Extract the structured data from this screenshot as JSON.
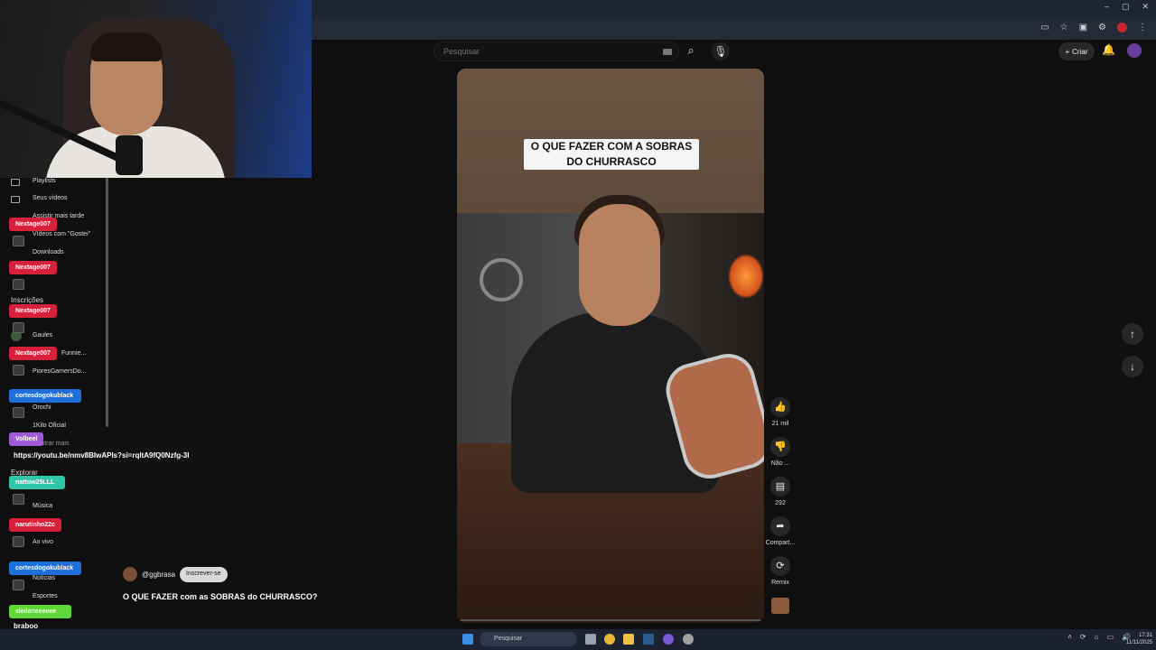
{
  "browser": {
    "window_controls": [
      "–",
      "▢",
      "✕"
    ]
  },
  "youtube_header": {
    "search_placeholder": "Pesquisar",
    "create_label": "Criar"
  },
  "sidebar": {
    "items": [
      {
        "label": "Playlists"
      },
      {
        "label": "Seus vídeos"
      },
      {
        "label": "Assistir mais tarde"
      },
      {
        "label": "Vídeos com \"Gostei\""
      },
      {
        "label": "Downloads"
      }
    ],
    "section_subscriptions": "Inscrições",
    "subscriptions": [
      {
        "label": "Gaules"
      },
      {
        "label": "Funnie..."
      },
      {
        "label": "PioresGamersDo..."
      },
      {
        "label": "Orochi"
      },
      {
        "label": "1Kilo Oficial"
      }
    ],
    "show_more": "Mostrar mais",
    "section_explore": "Explorar",
    "explore": [
      {
        "label": "Música"
      },
      {
        "label": "Ao vivo"
      },
      {
        "label": "Notícias"
      },
      {
        "label": "Esportes"
      }
    ]
  },
  "chat": {
    "badges": [
      {
        "name": "Nextage007",
        "color": "#d8203a"
      },
      {
        "name": "Nextage007",
        "color": "#d8203a"
      },
      {
        "name": "Nextage007",
        "color": "#d8203a"
      },
      {
        "name": "Nextage007",
        "color": "#d8203a"
      },
      {
        "name": "cortesdogokublack",
        "color": "#1e6fd9"
      },
      {
        "name": "Volbeel",
        "color": "#a35ad9"
      },
      {
        "name": "nattow25LLL",
        "color": "#2fc7a7"
      },
      {
        "name": "narutinho22c",
        "color": "#d8203a"
      },
      {
        "name": "cortesdogokublack",
        "color": "#1e6fd9"
      },
      {
        "name": "sleilaneeeeee",
        "color": "#5fd63a"
      }
    ],
    "link_message": "https://youtu.be/nmv8BIwAPIs?si=rqltA9fQ0Nzfg-3I",
    "last_message": "braboo"
  },
  "video": {
    "caption": "O QUE FAZER COM A SOBRAS DO CHURRASCO",
    "channel": "@ggbrasa",
    "subscribe_label": "Inscrever-se",
    "title": "O QUE FAZER com as SOBRAS do CHURRASCO?"
  },
  "actions": {
    "like_count": "21 mil",
    "dislike_label": "Não ...",
    "comments_count": "292",
    "share_label": "Compart...",
    "remix_label": "Remix"
  },
  "taskbar": {
    "search_placeholder": "Pesquisar",
    "time": "17:31",
    "date": "11/11/2025"
  }
}
